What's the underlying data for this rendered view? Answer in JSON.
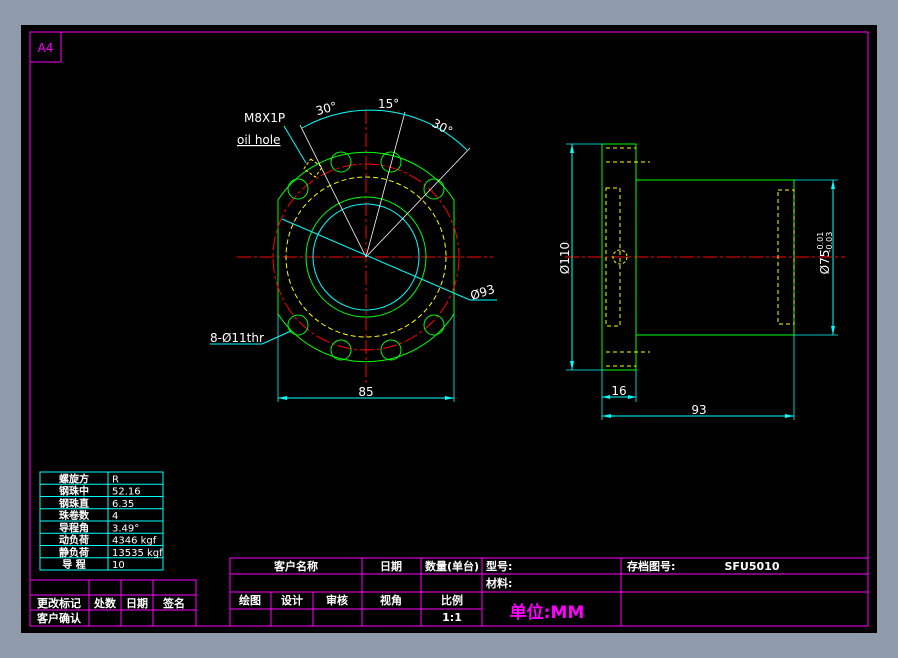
{
  "sheet": {
    "size_label": "A4"
  },
  "front_view": {
    "oil_hole_line1": "M8X1P",
    "oil_hole_line2": "oil hole",
    "angle_left": "30°",
    "angle_mid": "15°",
    "angle_right": "30°",
    "bolt_circle": "Ø93",
    "holes": "8-Ø11thr",
    "width": "85"
  },
  "side_view": {
    "flange_dia": "Ø110",
    "body_dia": "Ø75",
    "tol_upper": "-0.01",
    "tol_lower": "-0.03",
    "flange_thk": "16",
    "length": "93"
  },
  "spec_table": {
    "rows": [
      {
        "label": "螺旋方",
        "value": "R"
      },
      {
        "label": "钢珠中",
        "value": "52.16"
      },
      {
        "label": "钢珠直",
        "value": "6.35"
      },
      {
        "label": "珠卷数",
        "value": "4"
      },
      {
        "label": "导程角",
        "value": "3.49°"
      },
      {
        "label": "动负荷",
        "value": "4346 kgf"
      },
      {
        "label": "静负荷",
        "value": "13535 kgf"
      },
      {
        "label": "导  程",
        "value": "10"
      }
    ]
  },
  "revision_block": {
    "change_mark": "更改标记",
    "place": "处数",
    "date": "日期",
    "sign": "签名",
    "customer_confirm": "客户确认"
  },
  "title_block": {
    "customer_name": "客户名称",
    "date": "日期",
    "qty": "数量(单台)",
    "model_label": "型号:",
    "archive_label": "存档图号:",
    "archive_value": "SFU5010",
    "material_label": "材料:",
    "drawn": "绘图",
    "design": "设计",
    "check": "审核",
    "view_angle": "视角",
    "scale_label": "比例",
    "scale_value": "1:1",
    "unit": "单位:MM"
  }
}
